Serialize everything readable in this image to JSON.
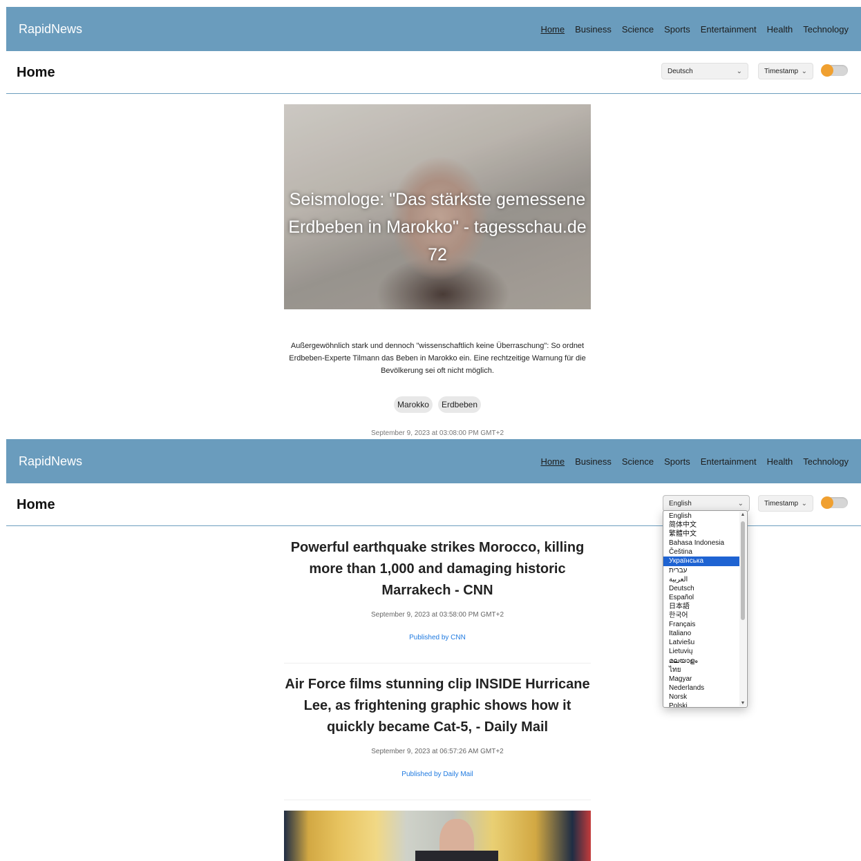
{
  "screen1": {
    "brand": "RapidNews",
    "nav": [
      "Home",
      "Business",
      "Science",
      "Sports",
      "Entertainment",
      "Health",
      "Technology"
    ],
    "page_title": "Home",
    "language_selected": "Deutsch",
    "sort_selected": "Timestamp",
    "article": {
      "title": "Seismologe: \"Das stärkste gemessene Erdbeben in Marokko\" - tagesschau.de 72",
      "description": "Außergewöhnlich stark und dennoch \"wissenschaftlich keine Überraschung\": So ordnet Erdbeben-Experte Tilmann das Beben in Marokko ein. Eine rechtzeitige Warnung für die Bevölkerung sei oft nicht möglich.",
      "tags": [
        "Marokko",
        "Erdbeben"
      ],
      "date": "September 9, 2023 at 03:08:00 PM GMT+2"
    }
  },
  "screen2": {
    "brand": "RapidNews",
    "nav": [
      "Home",
      "Business",
      "Science",
      "Sports",
      "Entertainment",
      "Health",
      "Technology"
    ],
    "page_title": "Home",
    "language_selected": "English",
    "sort_selected": "Timestamp",
    "language_options": [
      "English",
      "简体中文",
      "繁體中文",
      "Bahasa Indonesia",
      "Čeština",
      "Українська",
      "עברית",
      "العربية",
      "Deutsch",
      "Español",
      "日本語",
      "한국어",
      "Français",
      "Italiano",
      "Latviešu",
      "Lietuvių",
      "മലയാളം",
      "ไทย",
      "Magyar",
      "Nederlands",
      "Norsk",
      "Polski"
    ],
    "highlighted_option": "Українська",
    "articles": [
      {
        "title": "Powerful earthquake strikes Morocco, killing more than 1,000 and damaging historic Marrakech - CNN",
        "date": "September 9, 2023 at 03:58:00 PM GMT+2",
        "publisher": "Published by CNN"
      },
      {
        "title": "Air Force films stunning clip INSIDE Hurricane Lee, as frightening graphic shows how it quickly became Cat-5, - Daily Mail",
        "date": "September 9, 2023 at 06:57:26 AM GMT+2",
        "publisher": "Published by Daily Mail"
      }
    ]
  },
  "colors": {
    "navbar": "#6a9cbd",
    "accent_toggle": "#f0a030",
    "link": "#1f7ae0",
    "selected_option": "#1e63d2"
  },
  "icons": {
    "select_chevron": "chevron-down-icon",
    "scroll_up": "scroll-up-arrow-icon",
    "scroll_down": "scroll-down-arrow-icon"
  }
}
